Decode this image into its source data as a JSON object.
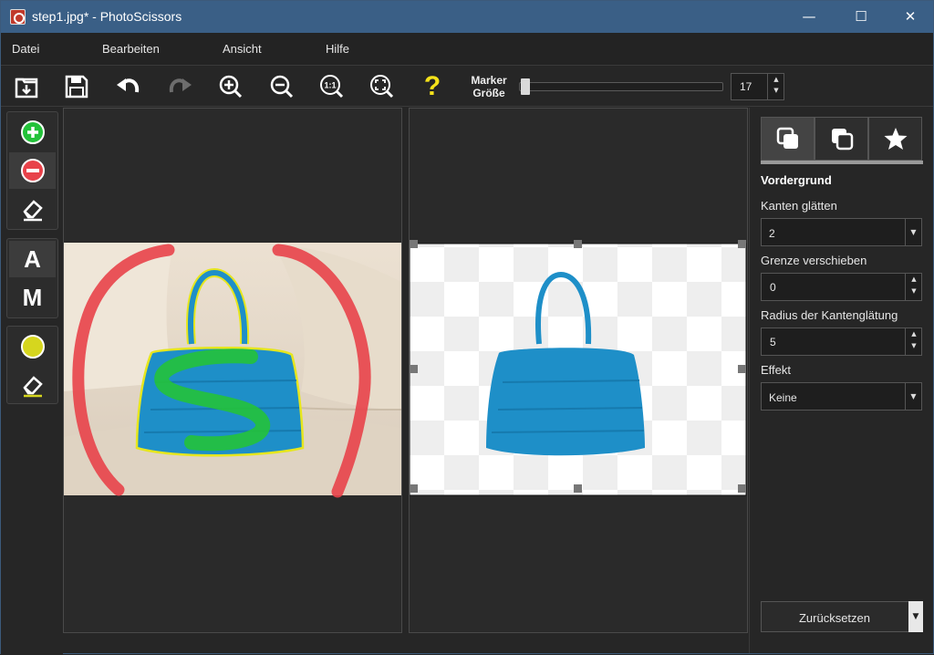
{
  "window": {
    "title": "step1.jpg* - PhotoScissors",
    "controls": [
      "minimize-icon",
      "maximize-icon",
      "close-icon"
    ]
  },
  "menu": {
    "items": [
      "Datei",
      "Bearbeiten",
      "Ansicht",
      "Hilfe"
    ]
  },
  "toolbar": {
    "buttons": [
      "open-icon",
      "save-icon",
      "undo-icon",
      "redo-icon",
      "zoom-in-icon",
      "zoom-out-icon",
      "zoom-actual-icon",
      "zoom-fit-icon",
      "help-icon"
    ],
    "actual_size_glyph": "1:1",
    "help_glyph": "?",
    "marker_label_line1": "Marker",
    "marker_label_line2": "Größe",
    "marker_size": "17",
    "marker_size_fraction": 0.02
  },
  "left_tools": {
    "groups": [
      [
        "foreground-marker-icon",
        "background-marker-icon",
        "eraser-icon"
      ],
      [
        "auto-mode-icon",
        "manual-mode-icon"
      ],
      [
        "color-marker-icon",
        "color-eraser-icon"
      ]
    ],
    "auto_glyph": "A",
    "manual_glyph": "M"
  },
  "right_panel": {
    "tabs": [
      "foreground-tab-icon",
      "background-tab-icon",
      "effects-tab-icon"
    ],
    "section_title": "Vordergrund",
    "fields": [
      {
        "label": "Kanten glätten",
        "value": "2",
        "type": "dropdown"
      },
      {
        "label": "Grenze verschieben",
        "value": "0",
        "type": "spin"
      },
      {
        "label": "Radius der Kantenglätung",
        "value": "5",
        "type": "spin"
      },
      {
        "label": "Effekt",
        "value": "Keine",
        "type": "dropdown"
      }
    ],
    "reset_label": "Zurücksetzen"
  },
  "colors": {
    "titlebar": "#3a5f86",
    "foreground_marker": "#23c23a",
    "background_marker": "#e8424a",
    "handbag": "#1e8fc8",
    "selection_outline": "#e6e61e"
  }
}
